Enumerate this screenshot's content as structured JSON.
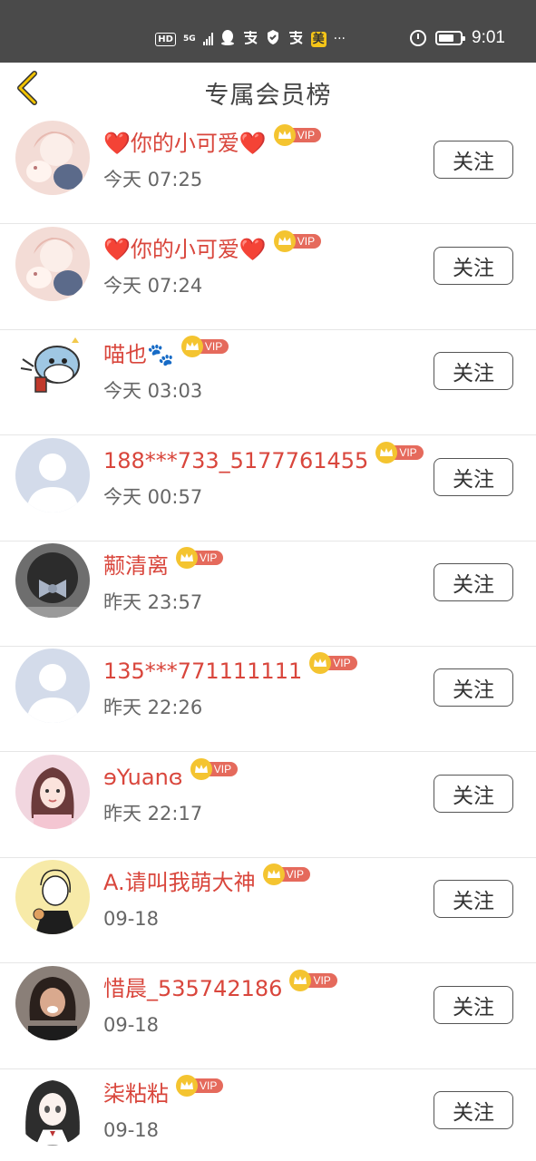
{
  "status_bar": {
    "time": "9:01",
    "hd_label": "HD",
    "network_label": "5G",
    "mei_label": "美",
    "more_label": "···"
  },
  "header": {
    "title": "专属会员榜"
  },
  "vip_label": "VIP",
  "members": [
    {
      "name": "❤️你的小可爱❤️",
      "time": "今天 07:25",
      "follow_label": "关注",
      "avatar": "avatar-anime-girl-pink"
    },
    {
      "name": "❤️你的小可爱❤️",
      "time": "今天 07:24",
      "follow_label": "关注",
      "avatar": "avatar-anime-girl-pink"
    },
    {
      "name": "喵也🐾",
      "time": "今天 03:03",
      "follow_label": "关注",
      "avatar": "avatar-cartoon-shark"
    },
    {
      "name": "188***733_5177761455",
      "time": "今天 00:57",
      "follow_label": "关注",
      "avatar": "avatar-default-person"
    },
    {
      "name": "颟清离",
      "time": "昨天 23:57",
      "follow_label": "关注",
      "avatar": "avatar-hair-bow-photo"
    },
    {
      "name": "135***771111111",
      "time": "昨天 22:26",
      "follow_label": "关注",
      "avatar": "avatar-default-person"
    },
    {
      "name": "ɘYuanɞ",
      "time": "昨天 22:17",
      "follow_label": "关注",
      "avatar": "avatar-girl-photo"
    },
    {
      "name": "A.请叫我萌大神",
      "time": "09-18",
      "follow_label": "关注",
      "avatar": "avatar-sketch-girl"
    },
    {
      "name": "惜晨_535742186",
      "time": "09-18",
      "follow_label": "关注",
      "avatar": "avatar-laughing-photo"
    },
    {
      "name": "柒粘粘",
      "time": "09-18",
      "follow_label": "关注",
      "avatar": "avatar-anime-dark-hair"
    }
  ]
}
